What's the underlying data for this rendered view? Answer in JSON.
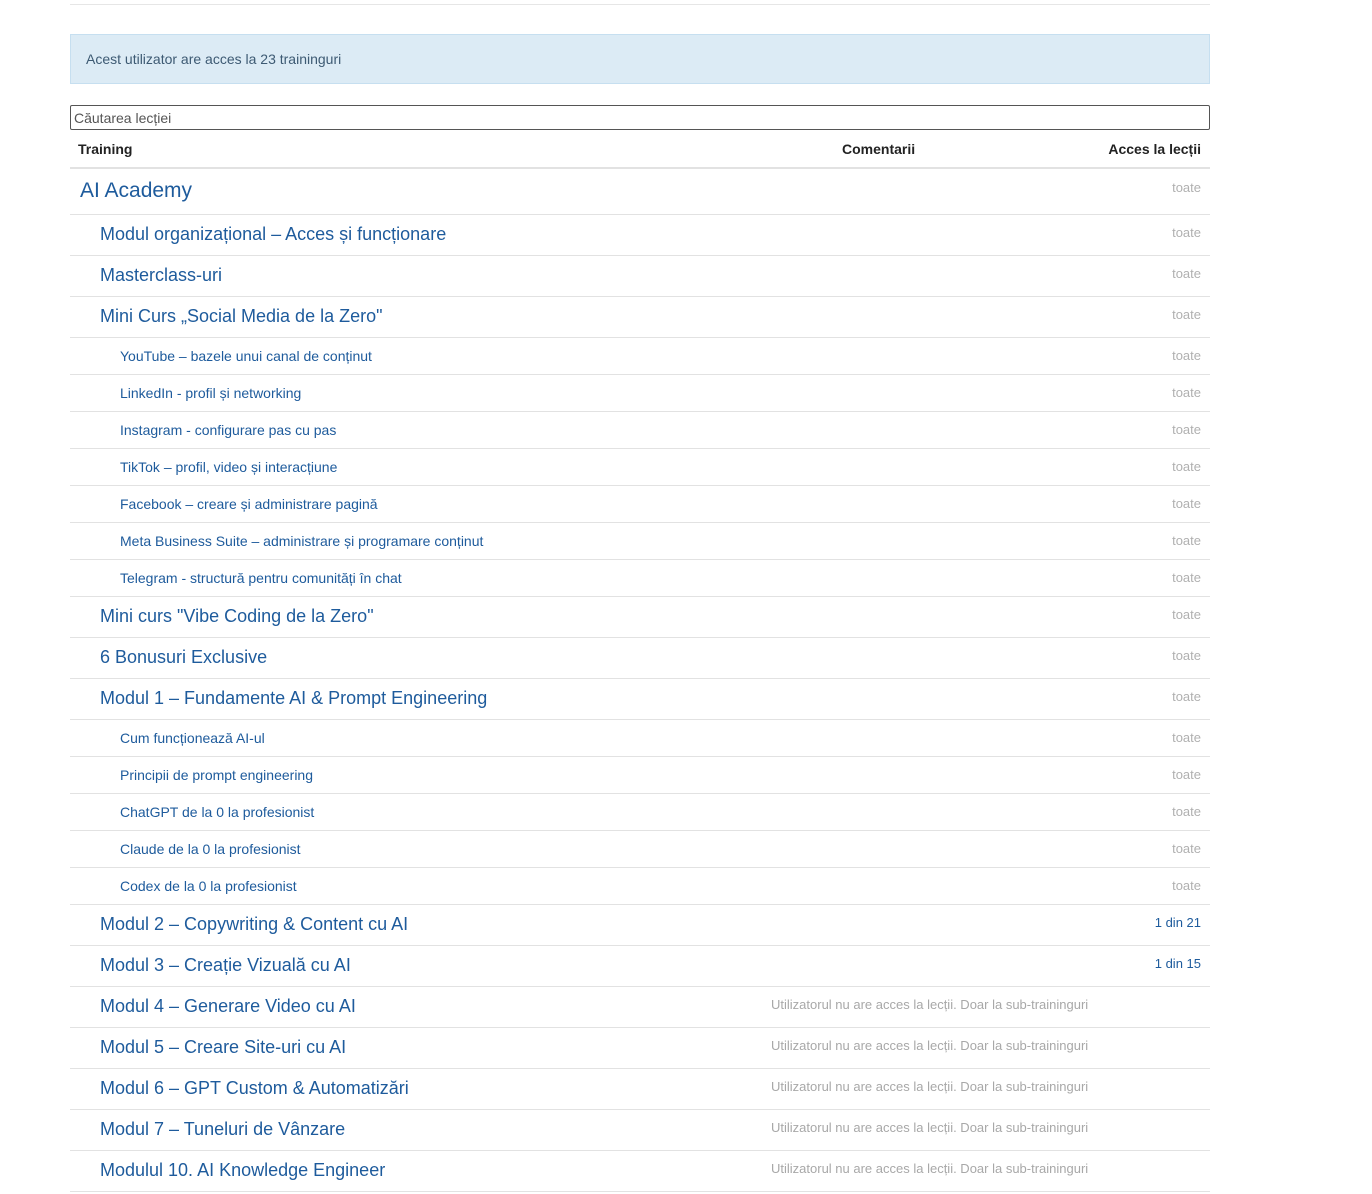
{
  "alert": {
    "text": "Acest utilizator are acces la 23 traininguri"
  },
  "search": {
    "placeholder": "Căutarea lecției"
  },
  "table": {
    "headers": {
      "training": "Training",
      "comments": "Comentarii",
      "access": "Acces la lecții"
    },
    "rows": [
      {
        "title": "AI Academy",
        "access": "toate",
        "level": 0
      },
      {
        "title": "Modul organizațional – Acces și funcționare",
        "access": "toate",
        "level": 1
      },
      {
        "title": "Masterclass-uri",
        "access": "toate",
        "level": 1
      },
      {
        "title": "Mini Curs „Social Media de la Zero\"",
        "access": "toate",
        "level": 1
      },
      {
        "title": "YouTube – bazele unui canal de conținut",
        "access": "toate",
        "level": 2
      },
      {
        "title": "LinkedIn - profil și networking",
        "access": "toate",
        "level": 2
      },
      {
        "title": "Instagram - configurare pas cu pas",
        "access": "toate",
        "level": 2
      },
      {
        "title": "TikTok – profil, video și interacțiune",
        "access": "toate",
        "level": 2
      },
      {
        "title": "Facebook – creare și administrare pagină",
        "access": "toate",
        "level": 2
      },
      {
        "title": "Meta Business Suite – administrare și programare conținut",
        "access": "toate",
        "level": 2
      },
      {
        "title": "Telegram - structură pentru comunități în chat",
        "access": "toate",
        "level": 2
      },
      {
        "title": "Mini curs \"Vibe Coding de la Zero\"",
        "access": "toate",
        "level": 1
      },
      {
        "title": "6 Bonusuri Exclusive",
        "access": "toate",
        "level": 1
      },
      {
        "title": "Modul 1 – Fundamente AI & Prompt Engineering",
        "access": "toate",
        "level": 1
      },
      {
        "title": "Cum funcționează AI-ul",
        "access": "toate",
        "level": 2
      },
      {
        "title": "Principii de prompt engineering",
        "access": "toate",
        "level": 2
      },
      {
        "title": "ChatGPT de la 0 la profesionist",
        "access": "toate",
        "level": 2
      },
      {
        "title": "Claude de la 0 la profesionist",
        "access": "toate",
        "level": 2
      },
      {
        "title": "Codex de la 0 la profesionist",
        "access": "toate",
        "level": 2
      },
      {
        "title": "Modul 2 – Copywriting & Content cu AI",
        "access": "1 din 21",
        "level": 1
      },
      {
        "title": "Modul 3 – Creație Vizuală cu AI",
        "access": "1 din 15",
        "level": 1
      },
      {
        "title": "Modul 4 – Generare Video cu AI",
        "note": "Utilizatorul nu are acces la lecții. Doar la sub-traininguri",
        "level": 1
      },
      {
        "title": "Modul 5 – Creare Site-uri cu AI",
        "note": "Utilizatorul nu are acces la lecții. Doar la sub-traininguri",
        "level": 1
      },
      {
        "title": "Modul 6 – GPT Custom & Automatizări",
        "note": "Utilizatorul nu are acces la lecții. Doar la sub-traininguri",
        "level": 1
      },
      {
        "title": "Modul 7 – Tuneluri de Vânzare",
        "note": "Utilizatorul nu are acces la lecții. Doar la sub-traininguri",
        "level": 1
      },
      {
        "title": "Modulul 10. AI Knowledge Engineer",
        "note": "Utilizatorul nu are acces la lecții. Doar la sub-traininguri",
        "level": 1
      }
    ]
  }
}
